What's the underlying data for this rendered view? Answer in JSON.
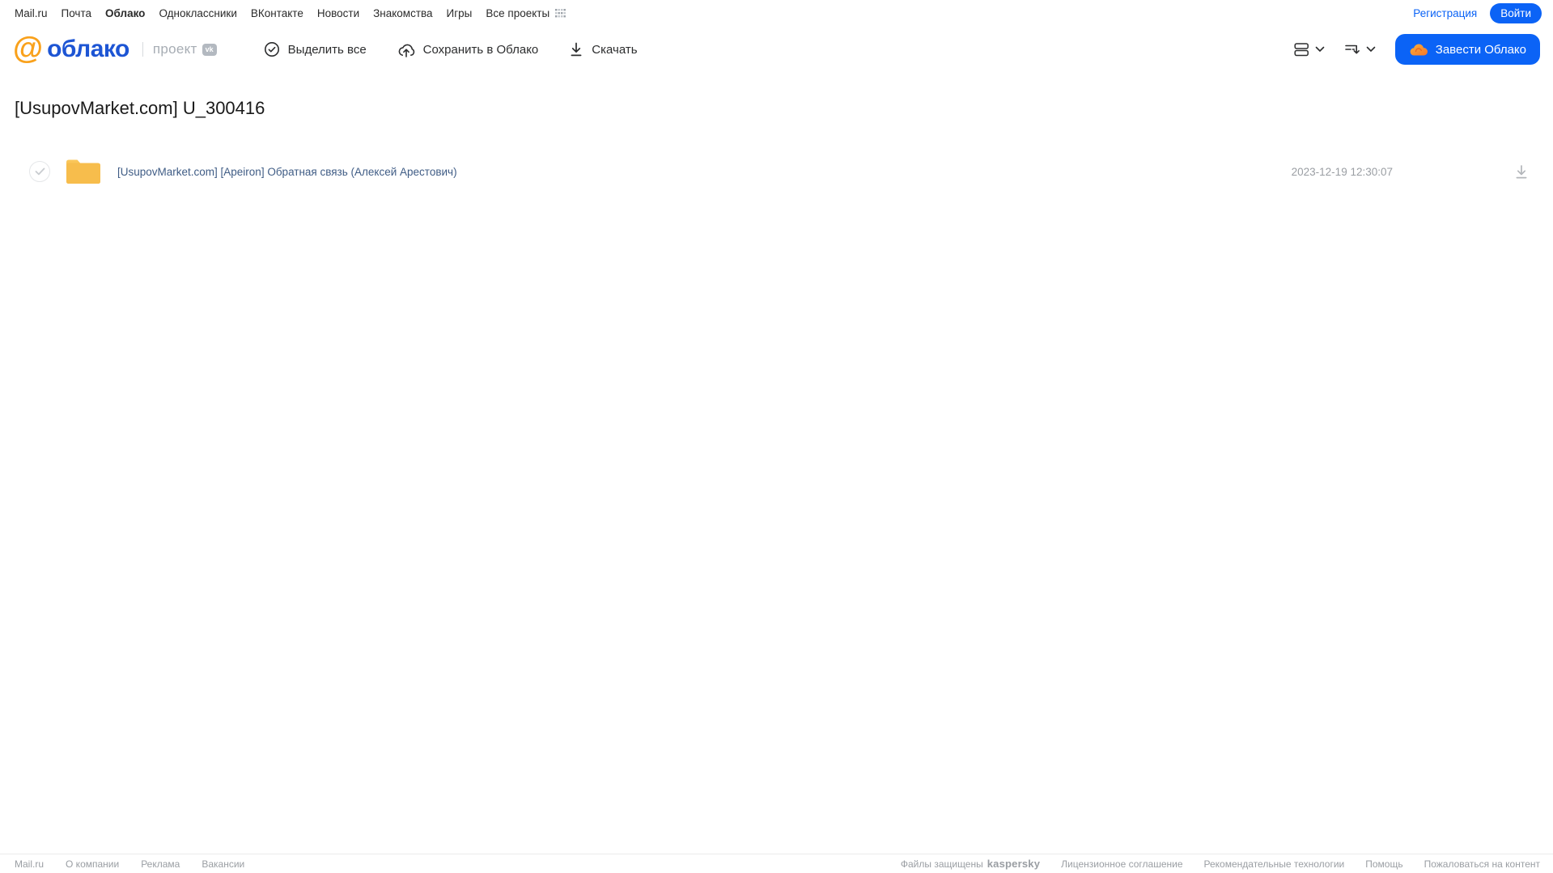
{
  "topnav": {
    "items": [
      "Mail.ru",
      "Почта",
      "Облако",
      "Одноклассники",
      "ВКонтакте",
      "Новости",
      "Знакомства",
      "Игры",
      "Все проекты"
    ],
    "register_label": "Регистрация",
    "login_label": "Войти"
  },
  "header": {
    "logo_at": "@",
    "logo_text": "облако",
    "project_label": "проект",
    "vk_badge": "vk",
    "toolbar": {
      "select_all": "Выделить все",
      "save_to_cloud": "Сохранить в Облако",
      "download": "Скачать"
    },
    "get_cloud_label": "Завести Облако"
  },
  "main": {
    "title": "[UsupovMarket.com] U_300416",
    "files": [
      {
        "type": "folder",
        "name": "[UsupovMarket.com] [Apeiron] Обратная связь (Алексей Арестович)",
        "date": "2023-12-19 12:30:07"
      }
    ]
  },
  "footer": {
    "left_links": [
      "Mail.ru",
      "О компании",
      "Реклама",
      "Вакансии"
    ],
    "protected_text": "Файлы защищены",
    "kaspersky_brand": "kaspersky",
    "right_links": [
      "Лицензионное соглашение",
      "Рекомендательные технологии",
      "Помощь",
      "Пожаловаться на контент"
    ]
  },
  "colors": {
    "accent_blue": "#0b63f6",
    "logo_blue": "#1d55d4",
    "logo_orange": "#f9a11b",
    "folder_top": "#fbc85b",
    "folder_bottom": "#f2ae3b",
    "kaspersky_green": "#00a88e",
    "file_link": "#3f5c85"
  }
}
